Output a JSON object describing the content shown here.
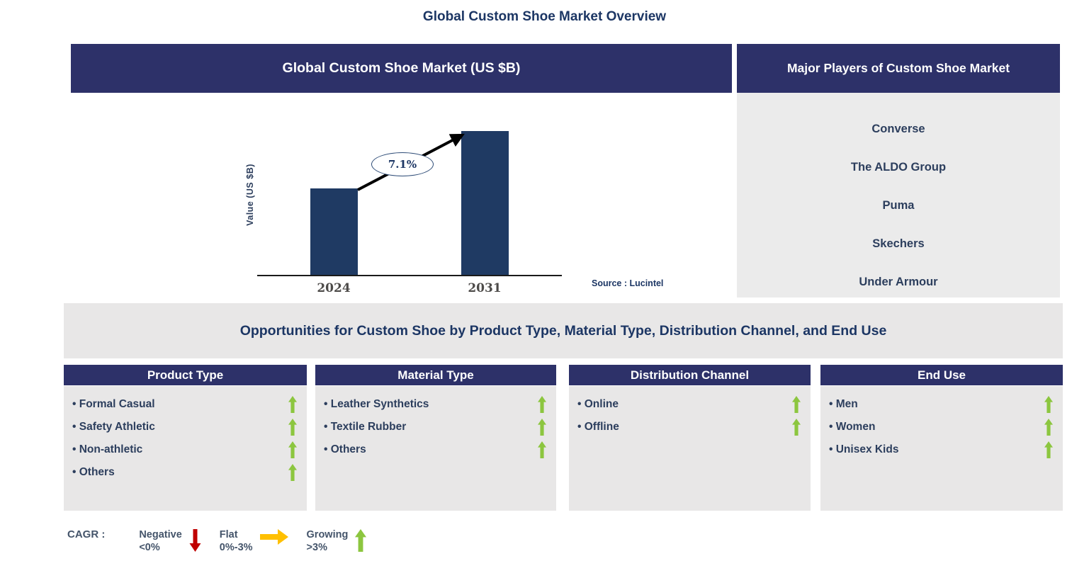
{
  "page_title": "Global Custom Shoe Market Overview",
  "colors": {
    "navy_header": "#2d3169",
    "navy_text": "#1c3664",
    "bar_fill": "#1f3a63",
    "panel_gray": "#e8e7e7",
    "growing": "#8cc63f",
    "negative": "#c00000",
    "flat": "#ffc000"
  },
  "market_chart": {
    "header": "Global Custom Shoe Market (US $B)",
    "cagr_label": "7.1%",
    "source": "Source : Lucintel"
  },
  "chart_data": {
    "type": "bar",
    "title": "Global Custom Shoe Market (US $B)",
    "categories": [
      "2024",
      "2031"
    ],
    "values": [
      1,
      1.66
    ],
    "values_note": "relative bar heights; no numeric axis scale shown",
    "ylabel": "Value (US $B)",
    "xlabel": "",
    "annotation": "7.1% CAGR growth arrow from 2024 bar to 2031 bar",
    "grid": false,
    "legend": false
  },
  "major_players": {
    "header": "Major Players of Custom Shoe Market",
    "items": [
      "Converse",
      "The ALDO Group",
      "Puma",
      "Skechers",
      "Under Armour"
    ]
  },
  "opportunities": {
    "title": "Opportunities for Custom Shoe by Product Type, Material Type, Distribution Channel, and End Use",
    "columns": [
      {
        "header": "Product Type",
        "items": [
          "Formal Casual",
          "Safety Athletic",
          "Non-athletic",
          "Others"
        ],
        "trend": "growing"
      },
      {
        "header": "Material Type",
        "items": [
          "Leather Synthetics",
          "Textile Rubber",
          "Others"
        ],
        "trend": "growing"
      },
      {
        "header": "Distribution Channel",
        "items": [
          "Online",
          "Offline"
        ],
        "trend": "growing"
      },
      {
        "header": "End Use",
        "items": [
          "Men",
          "Women",
          "Unisex Kids"
        ],
        "trend": "growing"
      }
    ]
  },
  "legend": {
    "label": "CAGR :",
    "entries": [
      {
        "name": "Negative",
        "range": "<0%",
        "icon": "down-arrow-icon",
        "color": "#c00000"
      },
      {
        "name": "Flat",
        "range": "0%-3%",
        "icon": "right-arrow-icon",
        "color": "#ffc000"
      },
      {
        "name": "Growing",
        "range": ">3%",
        "icon": "up-arrow-icon",
        "color": "#8cc63f"
      }
    ]
  }
}
